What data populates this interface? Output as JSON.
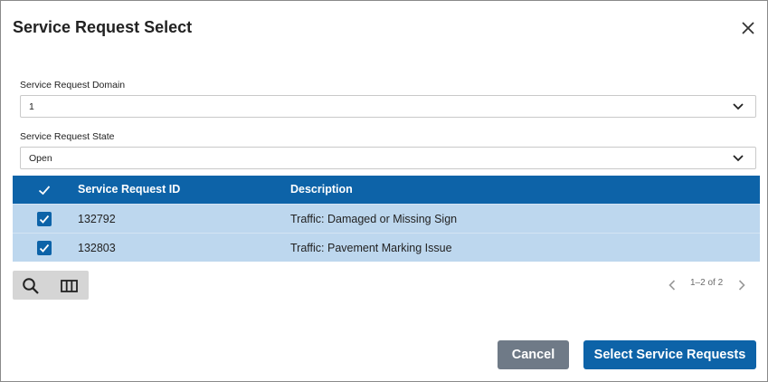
{
  "dialog": {
    "title": "Service Request Select",
    "close_icon": "close-icon"
  },
  "fields": {
    "domain": {
      "label": "Service Request Domain",
      "value": "1"
    },
    "state": {
      "label": "Service Request State",
      "value": "Open"
    }
  },
  "grid": {
    "columns": {
      "id": "Service Request ID",
      "description": "Description"
    },
    "rows": [
      {
        "checked": true,
        "id": "132792",
        "description": "Traffic: Damaged or Missing Sign"
      },
      {
        "checked": true,
        "id": "132803",
        "description": "Traffic: Pavement Marking Issue"
      }
    ]
  },
  "toolbar": {
    "icons": [
      "search-icon",
      "columns-icon"
    ]
  },
  "pager": {
    "text": "1–2 of 2"
  },
  "actions": {
    "cancel": "Cancel",
    "select": "Select Service Requests"
  },
  "colors": {
    "header": "#0d63a8",
    "row_selected": "#bdd7ee",
    "cancel": "#6f7a87"
  }
}
